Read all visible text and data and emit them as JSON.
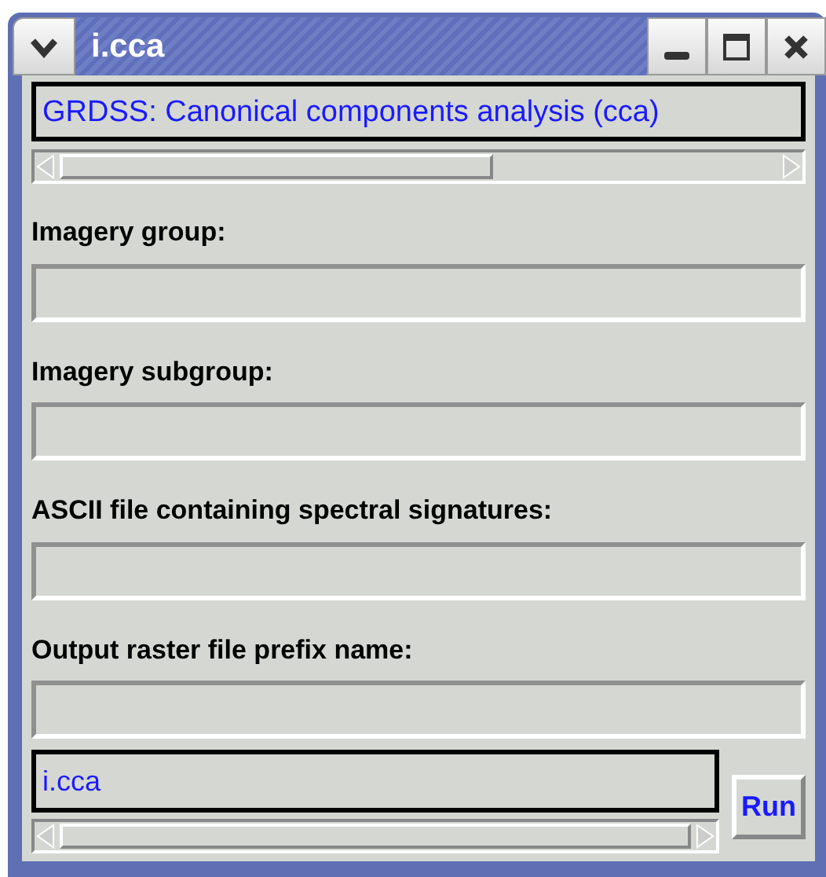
{
  "window": {
    "title": "i.cca"
  },
  "header": "GRDSS: Canonical components analysis (cca)",
  "fields": [
    {
      "label": "Imagery group:"
    },
    {
      "label": "Imagery subgroup:"
    },
    {
      "label": "ASCII file containing spectral signatures:"
    },
    {
      "label": "Output raster file prefix name:"
    }
  ],
  "command": {
    "value": "i.cca"
  },
  "run_button": "Run"
}
